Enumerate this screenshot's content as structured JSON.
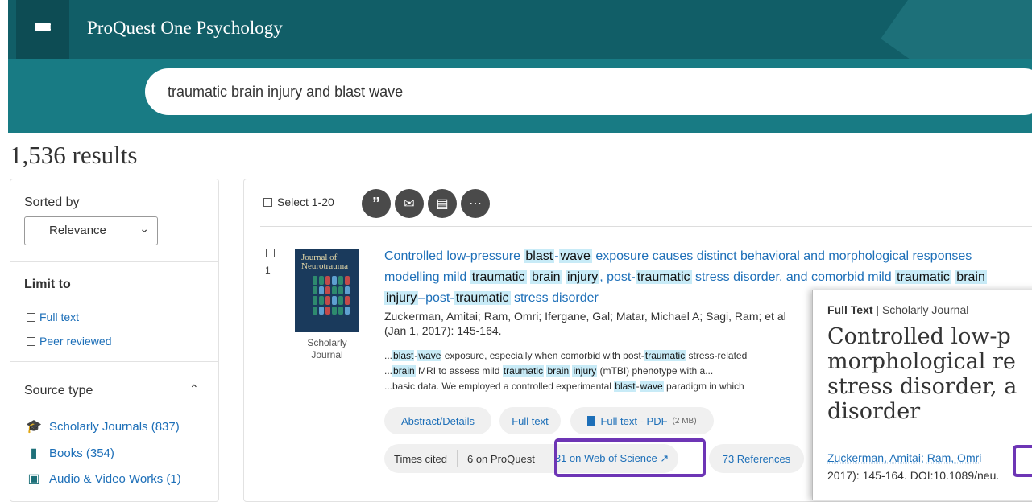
{
  "header": {
    "app_title": "ProQuest One Psychology"
  },
  "search": {
    "query": "traumatic brain injury and blast wave"
  },
  "results": {
    "count_text": "1,536 results"
  },
  "sidebar": {
    "sorted_by_label": "Sorted by",
    "sort_value": "Relevance",
    "limit_to_label": "Limit to",
    "limits": [
      "Full text",
      "Peer reviewed"
    ],
    "source_type_label": "Source type",
    "sources": [
      {
        "label": "Scholarly Journals (837)",
        "icon": "graduation-cap-icon"
      },
      {
        "label": "Books (354)",
        "icon": "book-icon"
      },
      {
        "label": "Audio & Video Works (1)",
        "icon": "film-icon"
      }
    ]
  },
  "toolbar": {
    "select_label": "Select 1-20"
  },
  "result1": {
    "number": "1",
    "cover_text": "Journal of Neurotrauma",
    "doc_type": "Scholarly Journal",
    "title_parts": {
      "p1": "Controlled low-pressure ",
      "h1": "blast",
      "p2": "-",
      "h2": "wave",
      "p3": " exposure causes distinct behavioral and morphological responses modelling mild ",
      "h3": "traumatic",
      "p4": " ",
      "h4": "brain",
      "p5": " ",
      "h5": "injury",
      "p6": ", post-",
      "h6": "traumatic",
      "p7": " stress disorder, and comorbid mild ",
      "h7": "traumatic",
      "p8": " ",
      "h8": "brain",
      "p9": " ",
      "h9": "injury",
      "p10": "–post-",
      "h10": "traumatic",
      "p11": " stress disorder"
    },
    "authors": "Zuckerman, Amitai; Ram, Omri; Ifergane, Gal; Matar, Michael A; Sagi, Ram; et al",
    "pub": "(Jan 1, 2017): 145-164.",
    "snip1": {
      "a": "...",
      "h1": "blast",
      "b": "-",
      "h2": "wave",
      "c": " exposure, especially when comorbid with post-",
      "h3": "traumatic",
      "d": " stress-related"
    },
    "snip2": {
      "a": "...",
      "h1": "brain",
      "b": " MRI to assess mild ",
      "h2": "traumatic",
      "c": " ",
      "h3": "brain",
      "d": " ",
      "h4": "injury",
      "e": " (mTBI) phenotype with a..."
    },
    "snip3": {
      "a": "...basic data. We employed a controlled experimental ",
      "h1": "blast",
      "b": "-",
      "h2": "wave",
      "c": " paradigm in which"
    },
    "links": {
      "abstract": "Abstract/Details",
      "fulltext": "Full text",
      "pdf": "Full text - PDF",
      "pdf_size": "(2 MB)"
    },
    "cited": {
      "label": "Times cited",
      "proquest": "6 on ProQuest",
      "wos": "31 on Web of Science",
      "refs": "73 References"
    }
  },
  "popup": {
    "meta_type": "Full Text",
    "meta_sep": "|",
    "meta_src": "Scholarly Journal",
    "title_lines": [
      "Controlled low-p",
      "morphological re",
      "stress disorder, a",
      "disorder"
    ],
    "author1": "Zuckerman, Amitai",
    "author2": "Ram, Omri",
    "doi_line": "2017): 145-164. DOI:10.1089/neu."
  },
  "colors": {
    "header_bg": "#115e67",
    "search_band": "#187b84",
    "link": "#1d6fb8",
    "highlight": "#c8ebf7",
    "focus_box": "#6d35b5"
  }
}
